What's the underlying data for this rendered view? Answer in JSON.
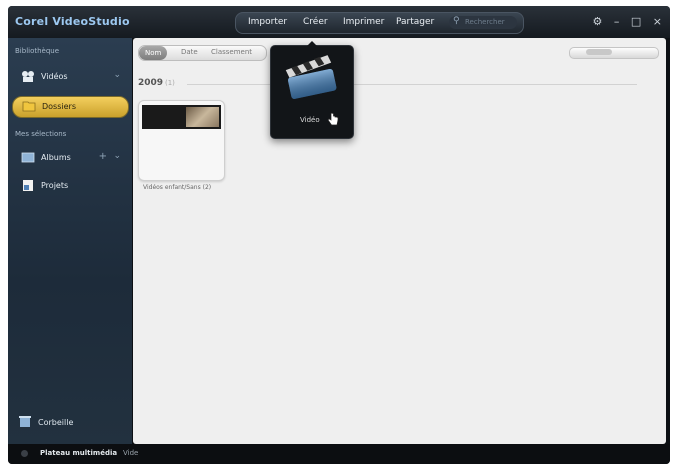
{
  "app": {
    "title": "Corel VideoStudio"
  },
  "menu": {
    "items": [
      "Importer",
      "Créer",
      "Imprimer",
      "Partager"
    ],
    "search_placeholder": "Rechercher"
  },
  "window_controls": [
    "help-icon",
    "minimize-icon",
    "maximize-icon",
    "close-icon"
  ],
  "sidebar": {
    "library_label": "Bibliothèque",
    "items": [
      {
        "label": "Vidéos",
        "icon": "videos-icon"
      },
      {
        "label": "Dossiers",
        "icon": "folder-icon",
        "active": true
      }
    ],
    "collections_label": "Mes sélections",
    "collections": [
      {
        "label": "Albums",
        "icon": "album-icon"
      },
      {
        "label": "Projets",
        "icon": "project-icon"
      }
    ],
    "trash_label": "Corbeille"
  },
  "toolbar": {
    "sort_buttons": [
      "Nom",
      "Date",
      "Classement"
    ],
    "active_sort": "Nom"
  },
  "content": {
    "year": "2009",
    "count": "(1)",
    "items": [
      {
        "caption": "Vidéos enfant/Sans (2)"
      }
    ]
  },
  "popup": {
    "label": "Vidéo",
    "icon": "clapperboard-icon"
  },
  "bottombar": {
    "label": "Plateau multimédia",
    "status": "Vide"
  },
  "colors": {
    "accent": "#e8c04a",
    "sidebar": "#24364a",
    "panel": "#efefef"
  }
}
